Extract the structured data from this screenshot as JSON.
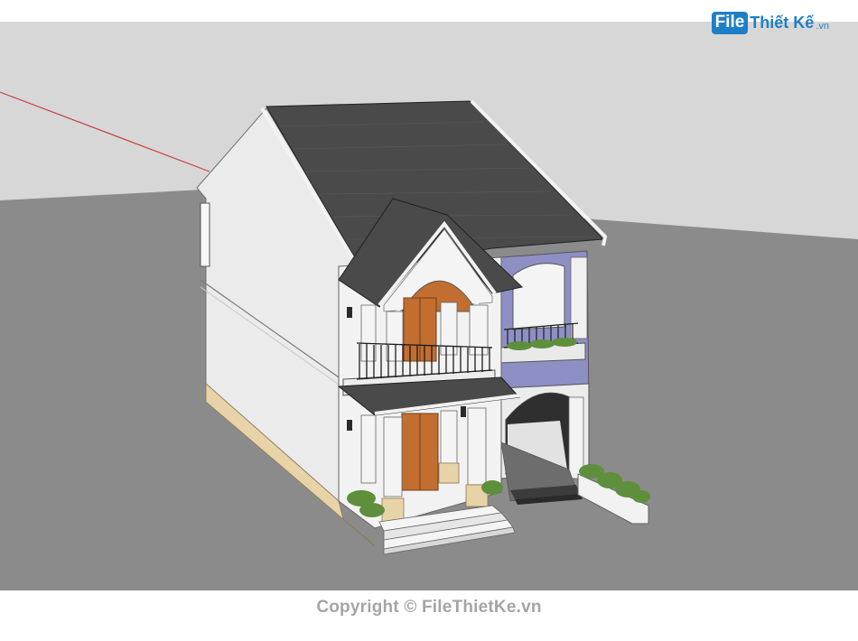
{
  "logo": {
    "file": "File",
    "rest": "Thiết Kế",
    "tld": ".vn"
  },
  "watermark": "Copyright © FileThietKe.vn",
  "colors": {
    "sky": "#d9d8d8",
    "ground": "#8b8b8b",
    "roof": "#4a4a4a",
    "wall": "#ececec",
    "accent_wall": "#8e8fc4",
    "door": "#c26e30",
    "railing": "#1c1c1c",
    "base": "#e7d3a7",
    "plants": "#5e8f3c"
  }
}
